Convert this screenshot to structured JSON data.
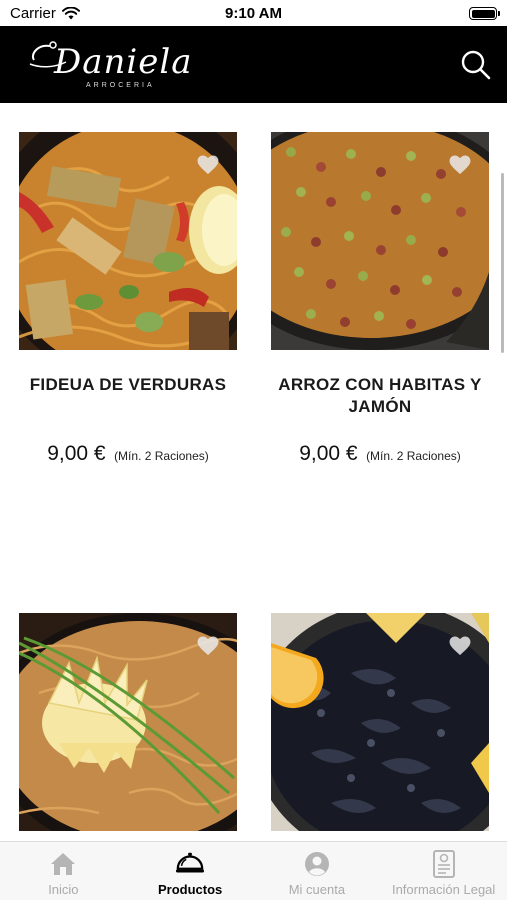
{
  "status_bar": {
    "carrier": "Carrier",
    "time": "9:10 AM"
  },
  "header": {
    "logo_text": "Daniela",
    "logo_subtitle": "ARROCERIA"
  },
  "products": [
    {
      "name": "FIDEUA DE VERDURAS",
      "price": "9,00 €",
      "min_note": "(Mín. 2 Raciones)",
      "photo": "fideua-verduras-photo"
    },
    {
      "name": "ARROZ CON HABITAS Y JAMÓN",
      "price": "9,00 €",
      "min_note": "(Mín. 2 Raciones)",
      "photo": "arroz-habitas-jamon-photo"
    },
    {
      "name": "",
      "price": "",
      "min_note": "",
      "photo": "paella-lemon-photo"
    },
    {
      "name": "",
      "price": "",
      "min_note": "",
      "photo": "arroz-negro-photo"
    }
  ],
  "tabs": [
    {
      "label": "Inicio",
      "icon": "home-icon",
      "active": false
    },
    {
      "label": "Productos",
      "icon": "cloche-icon",
      "active": true
    },
    {
      "label": "Mi cuenta",
      "icon": "account-icon",
      "active": false
    },
    {
      "label": "Información Legal",
      "icon": "legal-document-icon",
      "active": false
    }
  ],
  "colors": {
    "header_bg": "#000000",
    "active_tab": "#000000",
    "inactive_tab": "#aaaaaa"
  }
}
